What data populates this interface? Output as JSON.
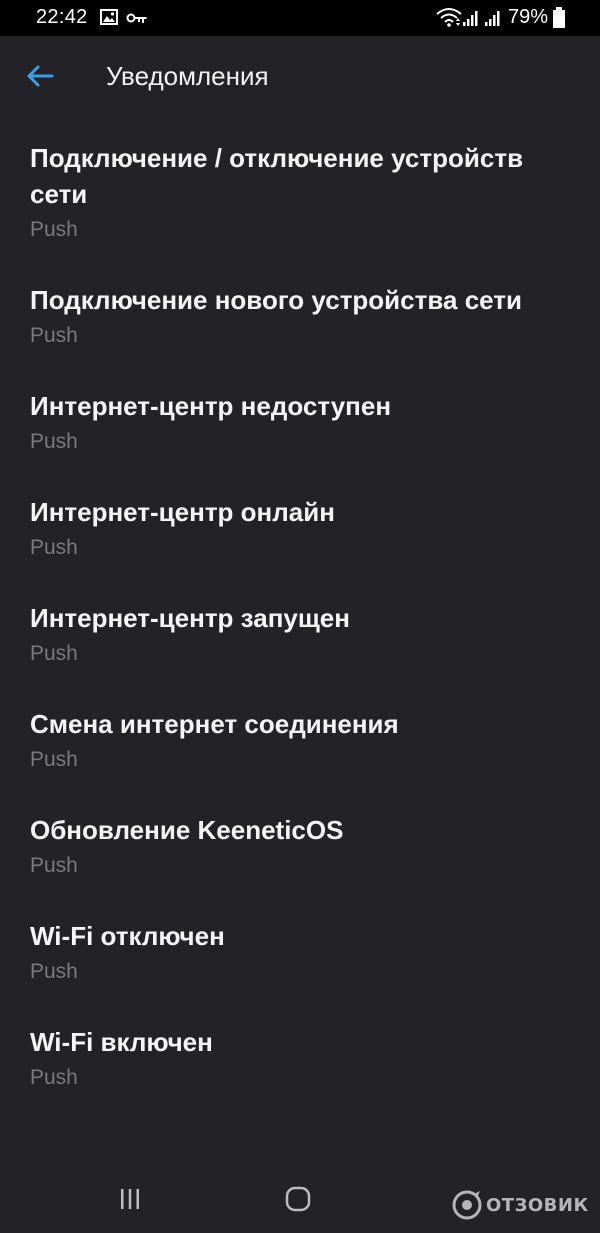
{
  "status_bar": {
    "time": "22:42",
    "battery": "79%",
    "icons": [
      "image-icon",
      "vpn-key-icon",
      "wifi-icon",
      "signal-icon",
      "signal-icon",
      "battery-icon"
    ]
  },
  "header": {
    "title": "Уведомления",
    "back_icon": "arrow-left-icon",
    "accent_color": "#3d9ee6"
  },
  "items": [
    {
      "title": "Подключение / отключение устройств сети",
      "subtitle": "Push"
    },
    {
      "title": "Подключение нового устройства сети",
      "subtitle": "Push"
    },
    {
      "title": "Интернет-центр недоступен",
      "subtitle": "Push"
    },
    {
      "title": "Интернет-центр онлайн",
      "subtitle": "Push"
    },
    {
      "title": "Интернет-центр запущен",
      "subtitle": "Push"
    },
    {
      "title": "Смена интернет соединения",
      "subtitle": "Push"
    },
    {
      "title": "Обновление KeeneticOS",
      "subtitle": "Push"
    },
    {
      "title": "Wi-Fi отключен",
      "subtitle": "Push"
    },
    {
      "title": "Wi-Fi включен",
      "subtitle": "Push"
    }
  ],
  "nav_bar": {
    "icons": [
      "recent-apps-icon",
      "home-icon"
    ]
  },
  "watermark": {
    "text": "ОТЗОВИК"
  },
  "colors": {
    "background": "#232327",
    "status_bar": "#000000",
    "title_text": "#f5f5f5",
    "subtitle_text": "#7a7a7e"
  }
}
